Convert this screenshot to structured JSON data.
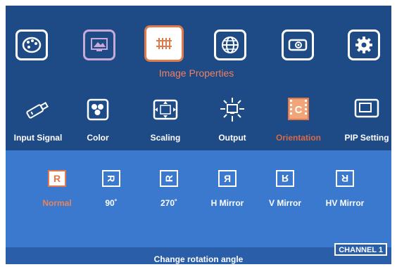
{
  "top_menu": {
    "items": [
      {
        "icon": "palette-icon",
        "state": "normal"
      },
      {
        "icon": "monitor-picture-icon",
        "state": "dim"
      },
      {
        "icon": "image-properties-icon",
        "state": "selected"
      },
      {
        "icon": "globe-icon",
        "state": "normal"
      },
      {
        "icon": "projector-icon",
        "state": "normal"
      },
      {
        "icon": "gear-icon",
        "state": "normal"
      }
    ],
    "group_title": "Image Properties"
  },
  "sub_menu": {
    "items": [
      {
        "label": "Input Signal",
        "icon": "input-plug-icon"
      },
      {
        "label": "Color",
        "icon": "color-balls-icon"
      },
      {
        "label": "Scaling",
        "icon": "scaling-arrows-icon"
      },
      {
        "label": "Output",
        "icon": "output-sun-icon"
      },
      {
        "label": "Orientation",
        "icon": "orientation-icon",
        "active": true
      },
      {
        "label": "PIP Setting",
        "icon": "pip-window-icon"
      }
    ]
  },
  "orientation_options": [
    {
      "label": "Normal",
      "glyph": "R",
      "selected": true
    },
    {
      "label": "90˚",
      "glyph": "R"
    },
    {
      "label": "270˚",
      "glyph": "R"
    },
    {
      "label": "H Mirror",
      "glyph": "R"
    },
    {
      "label": "V Mirror",
      "glyph": "R"
    },
    {
      "label": "HV Mirror",
      "glyph": "R"
    }
  ],
  "status": {
    "hint": "Change rotation angle",
    "channel": "CHANNEL 1"
  },
  "colors": {
    "background": "#1e4a86",
    "panel": "#3b79cf",
    "accent": "#e07a4a"
  }
}
